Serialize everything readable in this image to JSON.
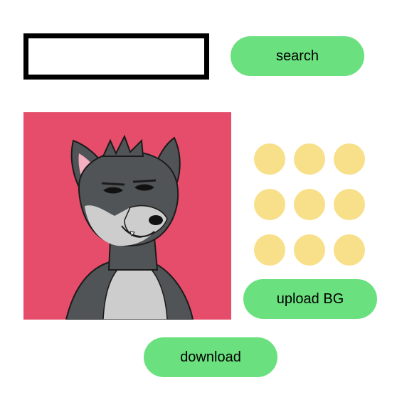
{
  "search": {
    "value": "",
    "placeholder": "",
    "button_label": "search"
  },
  "avatar": {
    "alt": "wolf character avatar"
  },
  "background_swatches": [
    {
      "color": "#F8E08A"
    },
    {
      "color": "#F8E08A"
    },
    {
      "color": "#F8E08A"
    },
    {
      "color": "#F8E08A"
    },
    {
      "color": "#F8E08A"
    },
    {
      "color": "#F8E08A"
    },
    {
      "color": "#F8E08A"
    },
    {
      "color": "#F8E08A"
    },
    {
      "color": "#F8E08A"
    }
  ],
  "upload_bg": {
    "label": "upload BG"
  },
  "download": {
    "label": "download"
  },
  "colors": {
    "button_green": "#6BE07F",
    "avatar_bg": "#E54D6A",
    "swatch_yellow": "#F8E08A",
    "wolf_dark": "#515456",
    "wolf_light": "#CDCDCD"
  }
}
